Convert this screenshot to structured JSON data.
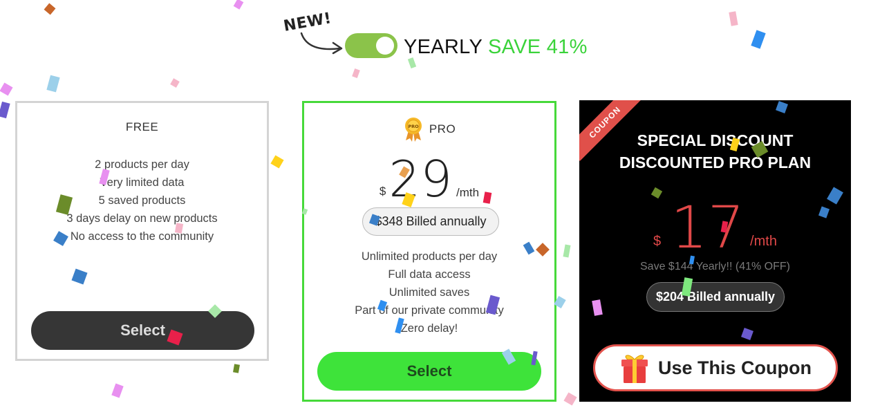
{
  "header": {
    "new_label": "NEW!",
    "toggle_state": "on",
    "yearly_label": "YEARLY",
    "save_label": "SAVE 41%"
  },
  "plans": {
    "free": {
      "name": "FREE",
      "features": [
        "2 products per day",
        "Very limited data",
        "5 saved products",
        "3 days delay on new products",
        "No access to the community"
      ],
      "button": "Select"
    },
    "pro": {
      "name": "PRO",
      "badge_icon": "medal-icon",
      "badge_text": "PRO",
      "currency": "$",
      "price": "29",
      "period": "/mth",
      "billed": "$348 Billed annually",
      "features": [
        "Unlimited products per day",
        "Full data access",
        "Unlimited saves",
        "Part of our private community",
        "Zero delay!"
      ],
      "button": "Select"
    },
    "coupon": {
      "ribbon": "COUPON",
      "title_line1": "SPECIAL DISCOUNT",
      "title_line2": "DISCOUNTED PRO PLAN",
      "currency": "$",
      "price": "17",
      "period": "/mth",
      "save_note": "Save $144 Yearly!! (41% OFF)",
      "billed": "$204 Billed annually",
      "button_icon": "gift-icon",
      "button": "Use This Coupon"
    }
  },
  "colors": {
    "toggle": "#8bc34a",
    "save_green": "#3ad33a",
    "pro_border": "#46d93a",
    "select_green": "#3ee33a",
    "coupon_red": "#e04848",
    "dark_button": "#363636"
  }
}
